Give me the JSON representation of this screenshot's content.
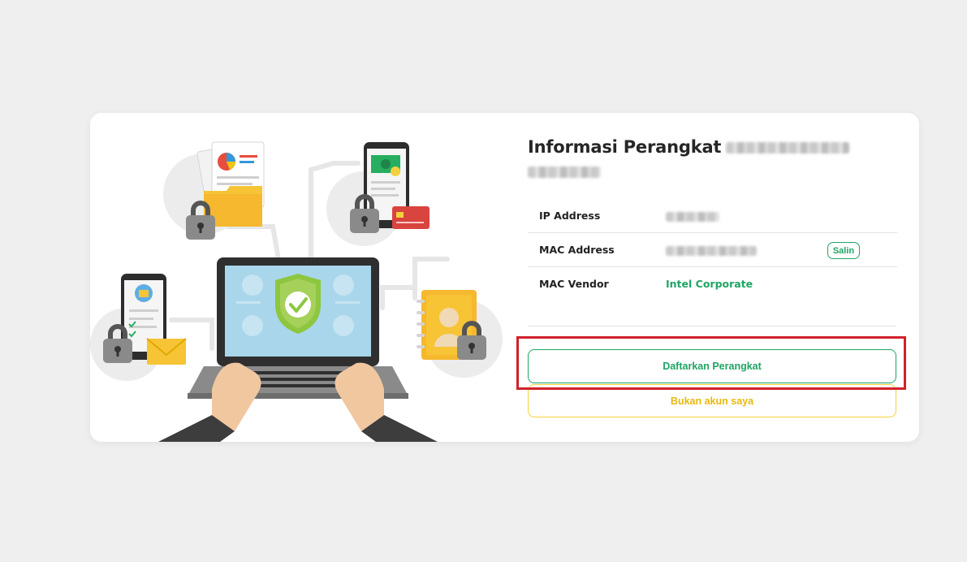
{
  "device_info": {
    "title": "Informasi Perangkat",
    "rows": [
      {
        "label": "IP Address",
        "value": ""
      },
      {
        "label": "MAC Address",
        "value": "",
        "action_label": "Salin"
      },
      {
        "label": "MAC Vendor",
        "value": "Intel Corporate"
      }
    ]
  },
  "actions": {
    "register_label": "Daftarkan Perangkat",
    "not_me_label": "Bukan akun saya"
  },
  "colors": {
    "background": "#efefef",
    "card": "#ffffff",
    "accent_green": "#1ea564",
    "accent_yellow": "#f4d33b",
    "highlight_red": "#d12129"
  },
  "illustration": {
    "icons": [
      "laptop-icon",
      "shield-check-icon",
      "padlock-icon",
      "document-icon",
      "phone-icon",
      "credit-card-icon",
      "envelope-icon",
      "contact-book-icon"
    ]
  }
}
